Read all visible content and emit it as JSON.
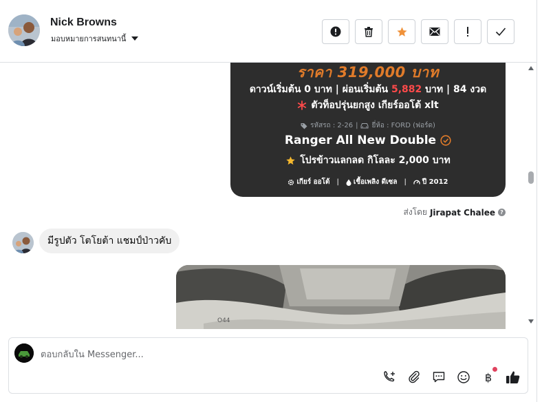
{
  "header": {
    "contact_name": "Nick Browns",
    "assign_label": "มอบหมายการสนทนานี้",
    "toolbar": [
      {
        "id": "spam",
        "icon": "alert-circle-icon"
      },
      {
        "id": "delete",
        "icon": "trash-icon"
      },
      {
        "id": "star",
        "icon": "star-icon"
      },
      {
        "id": "unread",
        "icon": "envelope-icon"
      },
      {
        "id": "follow-up",
        "icon": "exclamation-icon"
      },
      {
        "id": "done",
        "icon": "checkmark-icon"
      }
    ]
  },
  "listing_card": {
    "price": "ราคา 319,000 บาท",
    "finance_prefix": "ดาวน์เริ่มต้น 0 บาท | ผ่อนเริ่มต้น",
    "finance_amount": "5,882",
    "finance_suffix": "บาท | 84 งวด",
    "feature_line": "ตัวท็อปรุ่นยกสูง เกียร์ออโต้ xlt",
    "car_code": "รหัสรถ : 2-26",
    "brand": "ยี่ห้อ : FORD (ฟอร์ด)",
    "model": "Ranger All New Double",
    "promo": "โปรข้าวแลกลด กิโลละ 2,000 บาท",
    "gear": "เกียร์ ออโต้",
    "fuel": "เชื้อเพลิง ดีเซล",
    "year": "ปี 2012",
    "accent_color": "#e07b2a",
    "highlight_color": "#ff4a4a",
    "star_color": "#f5b82e"
  },
  "sent_by": {
    "prefix": "ส่งโดย",
    "name": "Jirapat Chalee"
  },
  "message": {
    "text": "มีรูปตัว โตโยต้า แชมป์ป่าวคับ"
  },
  "composer": {
    "placeholder": "ตอบกลับใน Messenger...",
    "currency_symbol": "฿",
    "icons": [
      "phone-add-icon",
      "paperclip-icon",
      "chat-bubble-icon",
      "emoji-icon",
      "baht-icon",
      "thumbs-up-icon"
    ]
  }
}
